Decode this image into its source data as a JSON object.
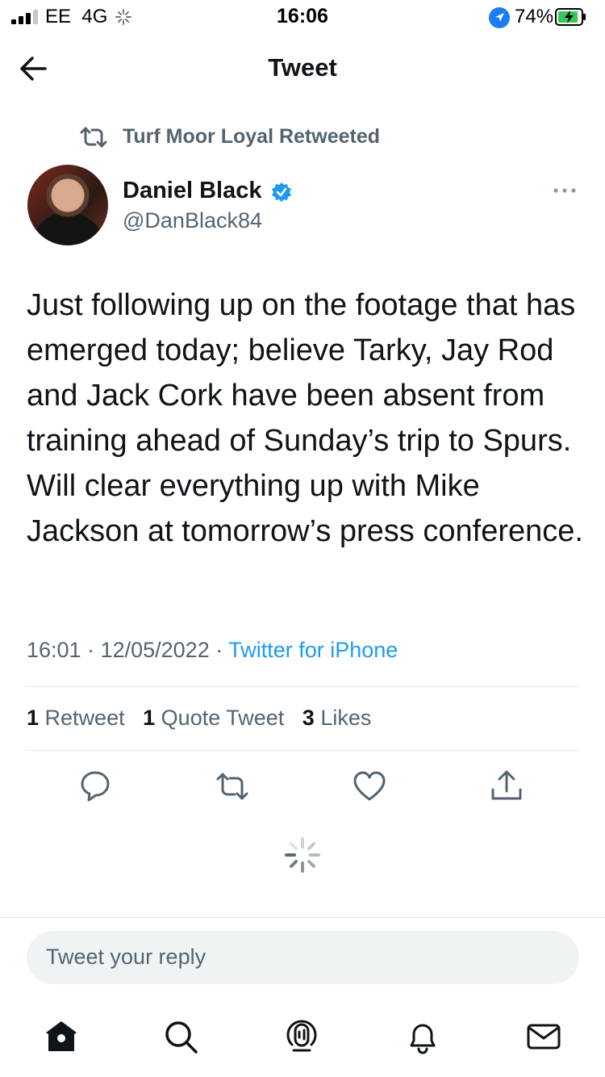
{
  "status_bar": {
    "carrier": "EE",
    "network": "4G",
    "time": "16:06",
    "battery": "74%"
  },
  "nav": {
    "title": "Tweet",
    "back_icon": "arrow-left-icon"
  },
  "retweet": {
    "text": "Turf Moor Loyal Retweeted",
    "icon": "retweet-icon"
  },
  "author": {
    "name": "Daniel Black",
    "handle": "@DanBlack84",
    "verified": true
  },
  "tweet": {
    "text": "Just following up on the footage that has emerged today; believe Tarky, Jay Rod and Jack Cork have been absent from training ahead of Sunday’s trip to Spurs. Will clear everything up with Mike Jackson at tomorrow’s press conference.",
    "time": "16:01",
    "date": "12/05/2022",
    "source": "Twitter for iPhone"
  },
  "stats": {
    "retweets_count": "1",
    "retweets_label": "Retweet",
    "quotes_count": "1",
    "quotes_label": "Quote Tweet",
    "likes_count": "3",
    "likes_label": "Likes"
  },
  "actions": [
    "reply-icon",
    "retweet-icon",
    "like-icon",
    "share-icon"
  ],
  "reply": {
    "placeholder": "Tweet your reply"
  },
  "tabs": [
    "home-icon",
    "search-icon",
    "spaces-icon",
    "notifications-icon",
    "messages-icon"
  ],
  "colors": {
    "accent": "#1d9bf0",
    "secondary_text": "#536471",
    "verified": "#1d9bf0"
  }
}
